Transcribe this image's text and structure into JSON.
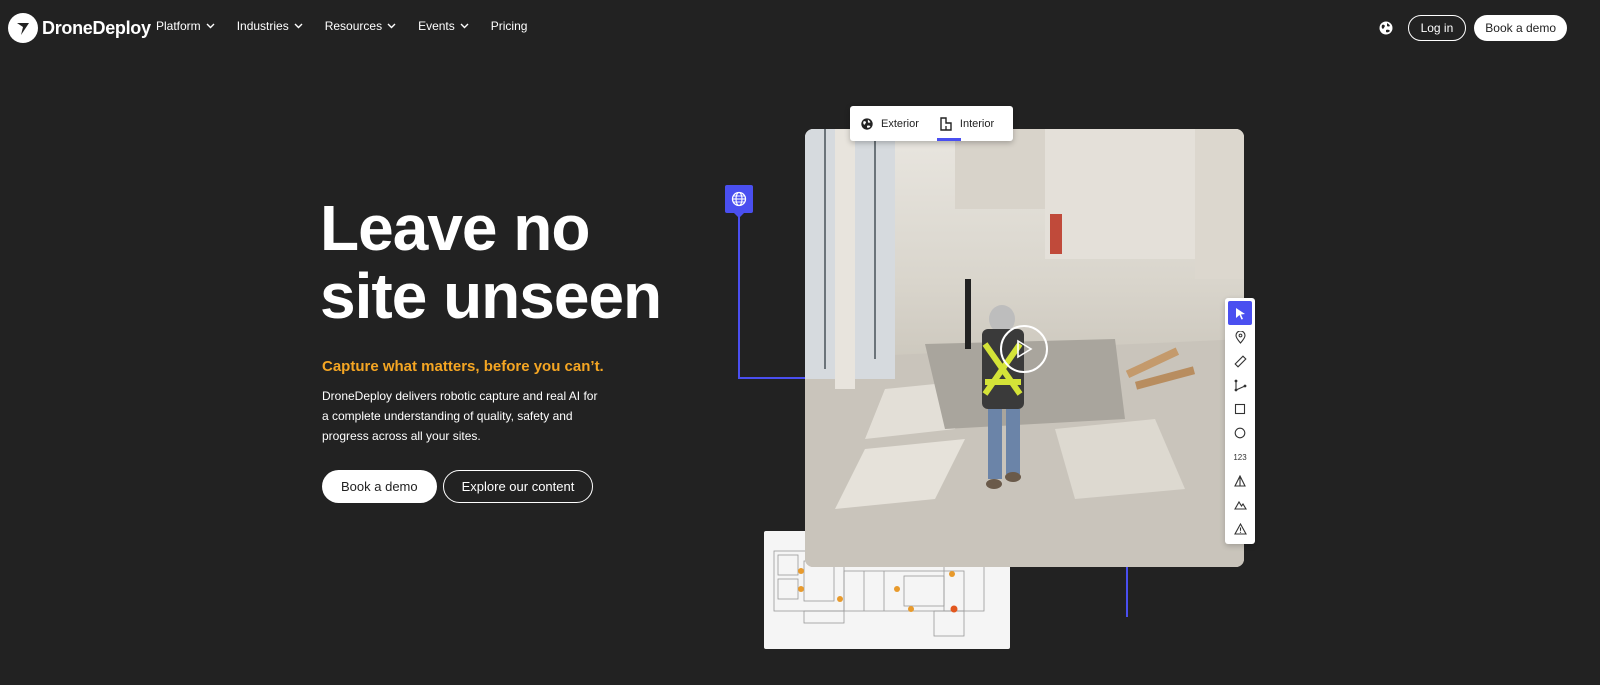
{
  "brand": {
    "name": "DroneDeploy"
  },
  "nav": {
    "items": [
      {
        "label": "Platform",
        "has_dropdown": true
      },
      {
        "label": "Industries",
        "has_dropdown": true
      },
      {
        "label": "Resources",
        "has_dropdown": true
      },
      {
        "label": "Events",
        "has_dropdown": true
      },
      {
        "label": "Pricing",
        "has_dropdown": false
      }
    ],
    "language_icon": "globe-icon",
    "login_label": "Log in",
    "demo_label": "Book a demo"
  },
  "hero": {
    "title_line1": "Leave no",
    "title_line2": "site unseen",
    "subtitle": "Capture what matters, before you can’t.",
    "description": "DroneDeploy delivers robotic capture and real AI for a complete understanding of quality, safety and progress across all your sites.",
    "primary_cta": "Book a demo",
    "secondary_cta": "Explore our content"
  },
  "viewer": {
    "tabs": [
      {
        "label": "Exterior",
        "icon": "globe-icon",
        "active": false
      },
      {
        "label": "Interior",
        "icon": "floorplan-icon",
        "active": true
      }
    ],
    "tools": [
      {
        "icon": "pointer-icon",
        "active": true
      },
      {
        "icon": "location-pin-icon",
        "active": false
      },
      {
        "icon": "ruler-icon",
        "active": false
      },
      {
        "icon": "polyline-icon",
        "active": false
      },
      {
        "icon": "rectangle-icon",
        "active": false
      },
      {
        "icon": "circle-icon",
        "active": false
      },
      {
        "icon": "count-icon",
        "label": "123",
        "active": false
      },
      {
        "icon": "volume-icon",
        "active": false
      },
      {
        "icon": "elevation-icon",
        "active": false
      },
      {
        "icon": "warning-icon",
        "active": false
      }
    ]
  },
  "colors": {
    "background": "#222222",
    "accent": "#4a4ff0",
    "subtitle": "#f5a623",
    "white": "#ffffff"
  }
}
